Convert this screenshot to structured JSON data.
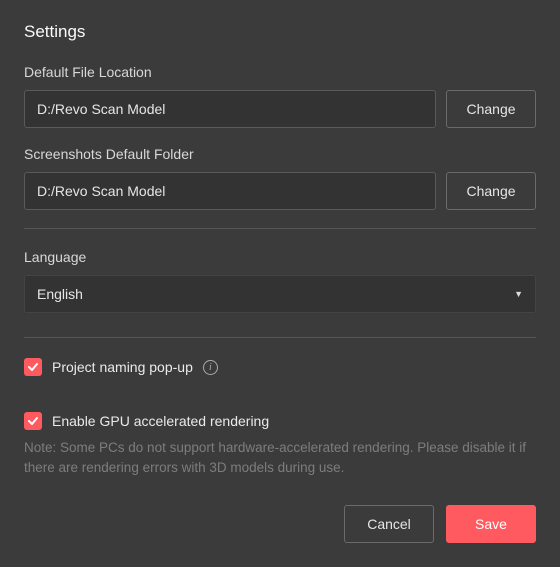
{
  "title": "Settings",
  "file_location": {
    "label": "Default File Location",
    "value": "D:/Revo Scan Model",
    "change_label": "Change"
  },
  "screenshots": {
    "label": "Screenshots Default Folder",
    "value": "D:/Revo Scan Model",
    "change_label": "Change"
  },
  "language": {
    "label": "Language",
    "value": "English"
  },
  "project_naming": {
    "label": "Project naming pop-up",
    "checked": true
  },
  "gpu": {
    "label": "Enable GPU accelerated rendering",
    "checked": true,
    "note": "Note: Some PCs do not support hardware-accelerated rendering. Please disable it if there are rendering errors with 3D models during use."
  },
  "footer": {
    "cancel": "Cancel",
    "save": "Save"
  },
  "colors": {
    "accent": "#ff5a5f",
    "bg": "#3b3b3b"
  }
}
